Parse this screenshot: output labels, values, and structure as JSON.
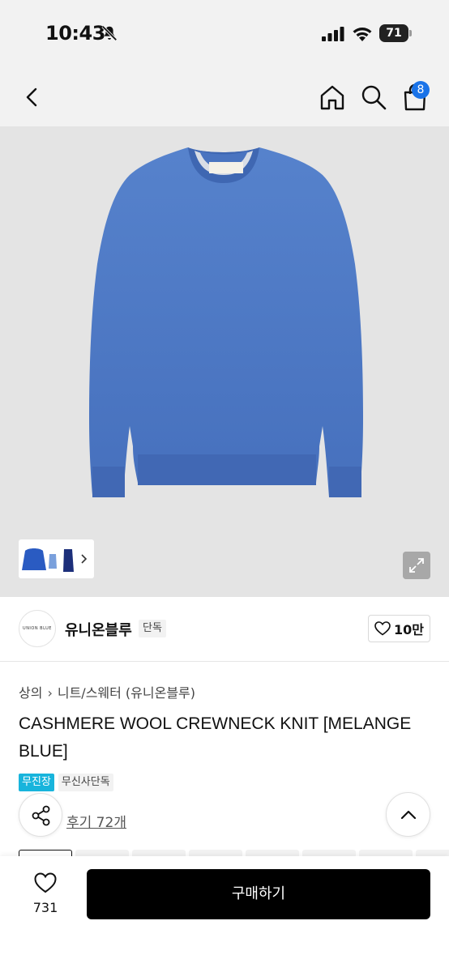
{
  "status_bar": {
    "time": "10:43",
    "battery": "71"
  },
  "nav": {
    "cart_count": "8",
    "icons": [
      "back-icon",
      "home-icon",
      "search-icon",
      "shopping-bag-icon"
    ]
  },
  "product_image": {
    "background": "#e4e4e4",
    "sweater_color": "#4d78c4"
  },
  "brand": {
    "logo_text": "UNION BLUE",
    "name": "유니온블루",
    "tag": "단독",
    "like_count": "10만"
  },
  "breadcrumb": {
    "items": [
      "상의",
      "니트/스웨터 (유니온블루)"
    ]
  },
  "product": {
    "title": "CASHMERE WOOL CREWNECK KNIT [MELANGE BLUE]",
    "tags": [
      "무진장",
      "무신사단독"
    ],
    "review_label": "후기 72개"
  },
  "bottom_bar": {
    "like_count": "731",
    "buy_label": "구매하기"
  },
  "colors": {
    "accent_blue": "#1a73e8",
    "tag_blue": "#18b4dc",
    "buy_button": "#000000"
  }
}
